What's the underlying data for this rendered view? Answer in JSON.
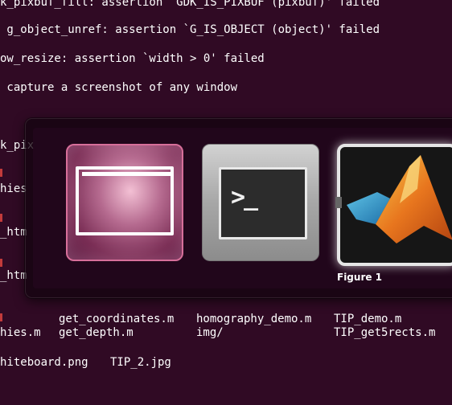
{
  "terminal": {
    "top_lines": [
      "k_pixbuf_fill: assertion `GDK_IS_PIXBUF (pixbuf)' failed",
      " g_object_unref: assertion `G_IS_OBJECT (object)' failed",
      "ow_resize: assertion `width > 0' failed",
      " capture a screenshot of any window"
    ],
    "left_fragments": [
      "k_pix",
      "hies",
      "_htm",
      "_htm"
    ],
    "listing_row1": [
      "get_coordinates.m",
      "homography_demo.m",
      "TIP_demo.m"
    ],
    "listing_row2": [
      "hies.m",
      "get_depth.m",
      "img/",
      "TIP_get5rects.m"
    ],
    "listing_row3": [
      "hiteboard.png",
      "TIP_2.jpg"
    ]
  },
  "switcher": {
    "apps": [
      {
        "name": "image-viewer",
        "icon": "image-viewer-icon"
      },
      {
        "name": "terminal",
        "icon": "terminal-icon",
        "prompt": ">_"
      },
      {
        "name": "matlab",
        "icon": "matlab-icon"
      }
    ],
    "selected_title": "Figure 1"
  },
  "colors": {
    "background": "#300a24",
    "selected_highlight": "#e6e6e6",
    "error_marker": "#c23b3b"
  }
}
